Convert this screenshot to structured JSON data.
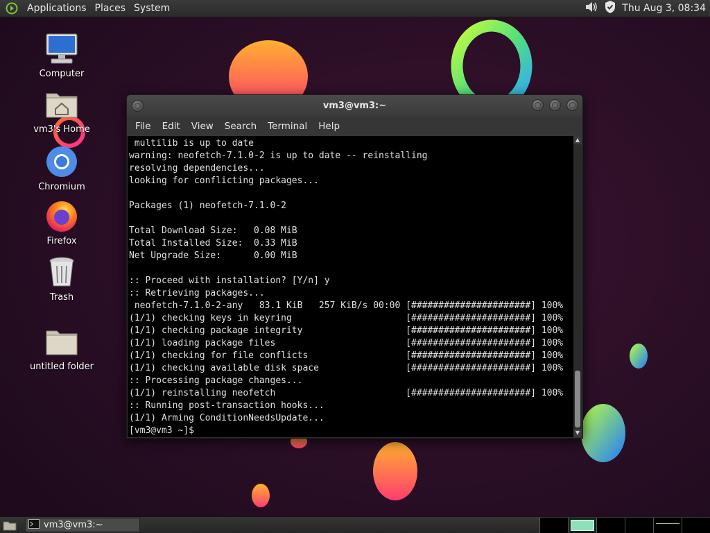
{
  "top_panel": {
    "menus": [
      "Applications",
      "Places",
      "System"
    ],
    "clock": "Thu Aug 3, 08:34",
    "tray_icons": [
      "volume-icon",
      "shield-check-icon"
    ]
  },
  "desktop_icons": [
    {
      "name": "Computer",
      "icon": "computer-icon"
    },
    {
      "name": "vm3's Home",
      "icon": "home-folder-icon"
    },
    {
      "name": "Chromium",
      "icon": "chromium-icon"
    },
    {
      "name": "Firefox",
      "icon": "firefox-icon"
    },
    {
      "name": "Trash",
      "icon": "trash-icon"
    },
    {
      "name": "untitled folder",
      "icon": "folder-icon"
    }
  ],
  "terminal": {
    "title": "vm3@vm3:~",
    "menu": [
      "File",
      "Edit",
      "View",
      "Search",
      "Terminal",
      "Help"
    ],
    "lines": [
      " multilib is up to date",
      "warning: neofetch-7.1.0-2 is up to date -- reinstalling",
      "resolving dependencies...",
      "looking for conflicting packages...",
      "",
      "Packages (1) neofetch-7.1.0-2",
      "",
      "Total Download Size:   0.08 MiB",
      "Total Installed Size:  0.33 MiB",
      "Net Upgrade Size:      0.00 MiB",
      "",
      ":: Proceed with installation? [Y/n] y",
      ":: Retrieving packages...",
      " neofetch-7.1.0-2-any   83.1 KiB   257 KiB/s 00:00 [######################] 100%",
      "(1/1) checking keys in keyring                     [######################] 100%",
      "(1/1) checking package integrity                   [######################] 100%",
      "(1/1) loading package files                        [######################] 100%",
      "(1/1) checking for file conflicts                  [######################] 100%",
      "(1/1) checking available disk space                [######################] 100%",
      ":: Processing package changes...",
      "(1/1) reinstalling neofetch                        [######################] 100%",
      ":: Running post-transaction hooks...",
      "(1/1) Arming ConditionNeedsUpdate...",
      "[vm3@vm3 ~]$ "
    ]
  },
  "taskbar": {
    "task_label": "vm3@vm3:~",
    "workspace_count": 6,
    "active_workspace": 2
  },
  "colors": {
    "wallpaper_bg": "#2a0f27",
    "panel_bg": "#2f2f2f",
    "terminal_bg": "#000000",
    "terminal_fg": "#e0e0e0"
  }
}
